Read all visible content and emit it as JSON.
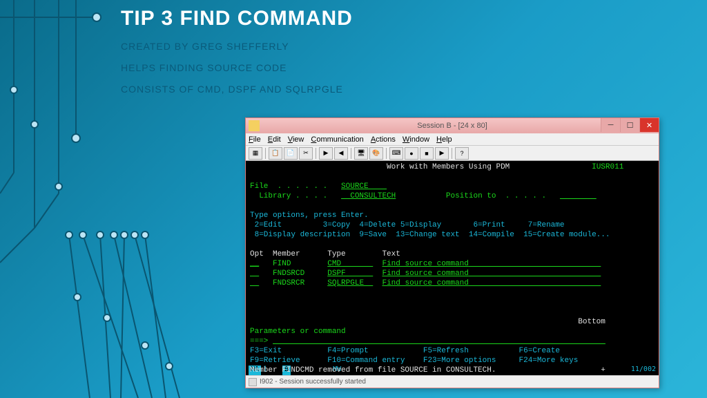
{
  "slide": {
    "title": "TIP 3 FIND COMMAND",
    "author": "CREATED BY GREG SHEFFERLY",
    "line1": "HELPS FINDING SOURCE CODE",
    "line2": "CONSISTS OF CMD, DSPF AND SQLRPGLE"
  },
  "window": {
    "title": "Session B - [24 x 80]",
    "menu": {
      "file": "File",
      "edit": "Edit",
      "view": "View",
      "comm": "Communication",
      "actions": "Actions",
      "window": "Window",
      "help": "Help"
    }
  },
  "terminal": {
    "screen_title": "Work with Members Using PDM",
    "user": "IUSR011",
    "file_label": "File  . . . . . .",
    "file_value": "SOURCE    ",
    "library_label": "  Library . . . .",
    "library_value": "  CONSULTECH",
    "position_label": "Position to  . . . . .",
    "instructions": "Type options, press Enter.",
    "opts_line1": " 2=Edit         3=Copy  4=Delete 5=Display       6=Print     7=Rename",
    "opts_line2": " 8=Display description  9=Save  13=Change text  14=Compile  15=Create module...",
    "headers": {
      "opt": "Opt",
      "member": "Member",
      "type": "Type",
      "text": "Text"
    },
    "rows": [
      {
        "opt": "__",
        "member": "FIND   ",
        "type": "CMD       ",
        "text": "Find source command"
      },
      {
        "opt": "  ",
        "member": "FNDSRCD",
        "type": "DSPF      ",
        "text": "Find source command"
      },
      {
        "opt": "  ",
        "member": "FNDSRCR",
        "type": "SQLRPGLE  ",
        "text": "Find source command"
      }
    ],
    "bottom": "Bottom",
    "params_label": "Parameters or command",
    "prompt": "===>",
    "fkeys_line1": {
      "f3": "F3=Exit",
      "f4": "F4=Prompt",
      "f5": "F5=Refresh",
      "f6": "F6=Create"
    },
    "fkeys_line2": {
      "f9": "F9=Retrieve",
      "f10": "F10=Command entry",
      "f23": "F23=More options",
      "f24": "F24=More keys"
    },
    "message": "Member FINDCMD removed from file SOURCE in CONSULTECH.                       +"
  },
  "status1": {
    "ma": "MA",
    "b": "B",
    "mw": "MW",
    "pos": "11/002"
  },
  "status2": {
    "text": "I902 - Session successfully started"
  }
}
